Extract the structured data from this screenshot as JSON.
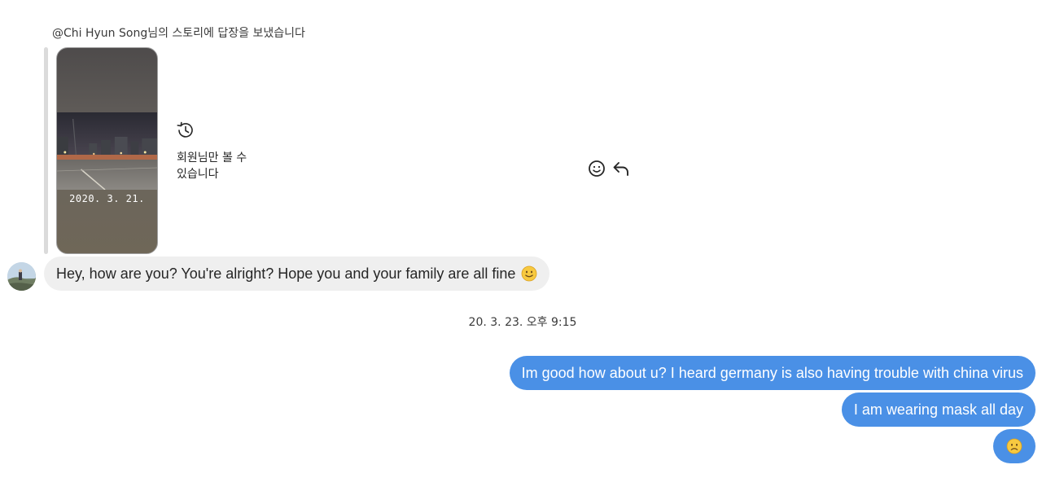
{
  "story_reply": {
    "caption": "@Chi Hyun Song님의 스토리에 답장을 보냈습니다",
    "story_date": "2020. 3. 21.",
    "expired_text": "회원님만 볼 수 있습니다",
    "expired_icon": "history-clock-icon"
  },
  "message_actions": {
    "react_icon": "smiley-icon",
    "reply_icon": "reply-arrow-icon"
  },
  "messages": {
    "incoming": [
      {
        "text": "Hey, how are you? You're alright? Hope you and your family are all fine",
        "emoji": "slightly-smiling-face"
      }
    ],
    "timestamp": "20. 3. 23. 오후 9:15",
    "outgoing": [
      {
        "text": "Im good how about u? I heard germany is also having trouble with china virus"
      },
      {
        "text": "I am wearing mask all day"
      },
      {
        "text": "",
        "emoji": "frowning-face"
      }
    ]
  },
  "colors": {
    "outgoing_bubble": "#4a90e6",
    "incoming_bubble": "#efefef",
    "quote_bar": "#dbdbdb"
  }
}
